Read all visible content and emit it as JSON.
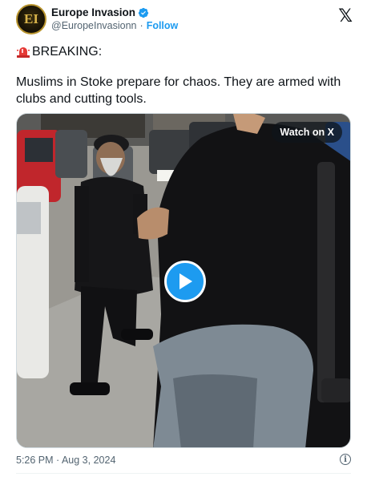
{
  "author": {
    "display_name": "Europe Invasion",
    "handle": "@EuropeInvasionn",
    "avatar_initials": "EI",
    "follow_label": "Follow",
    "separator": "·",
    "verified_icon": "verified-badge-icon"
  },
  "platform_logo": "𝕏",
  "tweet": {
    "breaking_label": "BREAKING:",
    "siren_icon": "police-siren-icon",
    "text": "Muslims in Stoke prepare for chaos. They are armed with clubs and cutting tools."
  },
  "media": {
    "watch_label": "Watch on X",
    "play_icon": "play-icon"
  },
  "footer": {
    "timestamp": "5:26 PM · Aug 3, 2024",
    "info_icon": "info-icon",
    "info_glyph": "i"
  },
  "colors": {
    "accent": "#1d9bf0",
    "text_primary": "#0f1419",
    "text_secondary": "#536471"
  }
}
